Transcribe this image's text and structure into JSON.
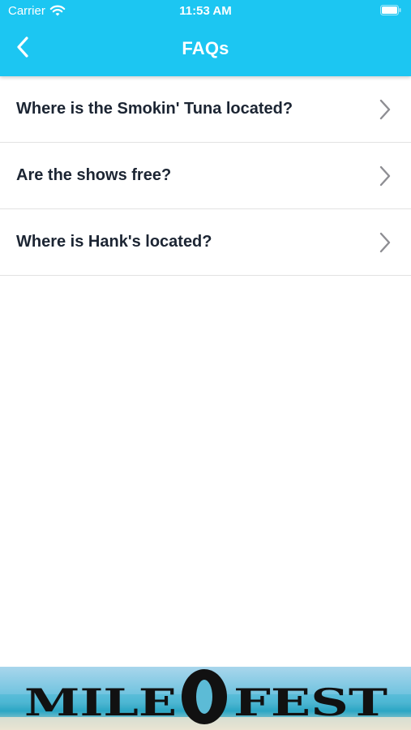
{
  "status_bar": {
    "carrier": "Carrier",
    "time": "11:53 AM",
    "icons": [
      "wifi-icon",
      "battery-icon"
    ]
  },
  "nav": {
    "title": "FAQs",
    "back_icon": "chevron-left-icon"
  },
  "faqs": [
    {
      "question": "Where is the Smokin' Tuna located?"
    },
    {
      "question": "Are the shows free?"
    },
    {
      "question": "Where is Hank's located?"
    }
  ],
  "banner": {
    "logo_text": "MILE 0 FEST"
  },
  "colors": {
    "header": "#1cc6f2",
    "text": "#1c2533",
    "divider": "#e2e2e2",
    "chevron": "#8e8e93"
  }
}
